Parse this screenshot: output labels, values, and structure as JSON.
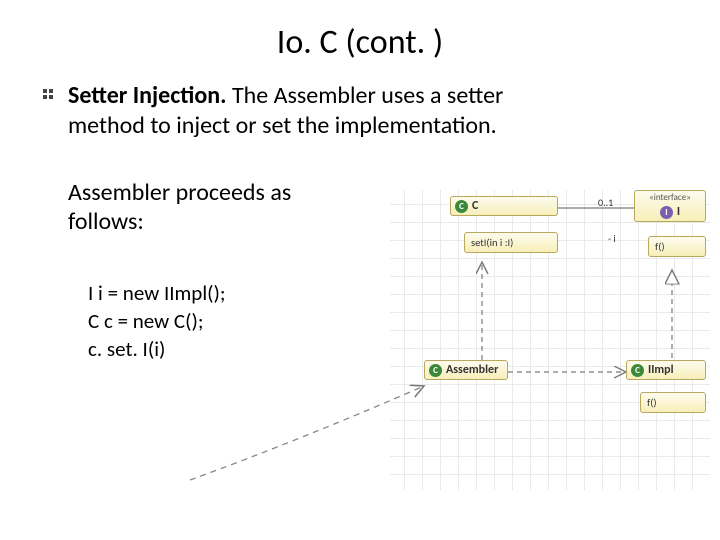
{
  "title": "Io. C (cont. )",
  "bullet": {
    "strong": "Setter Injection.",
    "rest": " The Assembler uses a setter method to inject or set the implementation."
  },
  "sub1": "Assembler proceeds as follows:",
  "code": {
    "l1": "I i = new IImpl();",
    "l2": "C c = new C();",
    "l3": "c. set. I(i)"
  },
  "diagram": {
    "c_class": {
      "name": "C",
      "op": "setI(in i :I)"
    },
    "i_iface": {
      "stereo": "«interface»",
      "name": "I",
      "op": "f()"
    },
    "assembler": {
      "name": "Assembler"
    },
    "iimpl": {
      "name": "IImpl",
      "op": "f()"
    },
    "assoc": {
      "mult": "0..1",
      "role": "- i"
    }
  }
}
